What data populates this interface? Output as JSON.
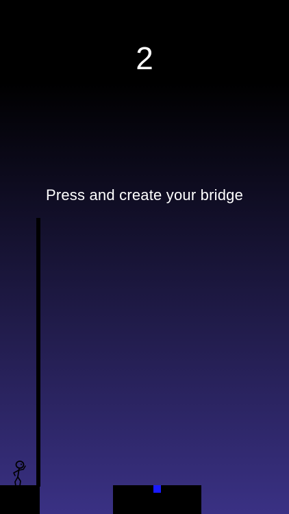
{
  "hud": {
    "score": "2",
    "prompt": "Press and create your bridge"
  },
  "scene": {
    "sky_top_color": "#000000",
    "sky_bottom_color": "#3a3184",
    "platform_color": "#000000",
    "stick_color": "#000000",
    "bonus_color": "#1a1aff"
  },
  "icons": {
    "hero": "stick-figure-icon",
    "bonus": "target-square-icon"
  }
}
